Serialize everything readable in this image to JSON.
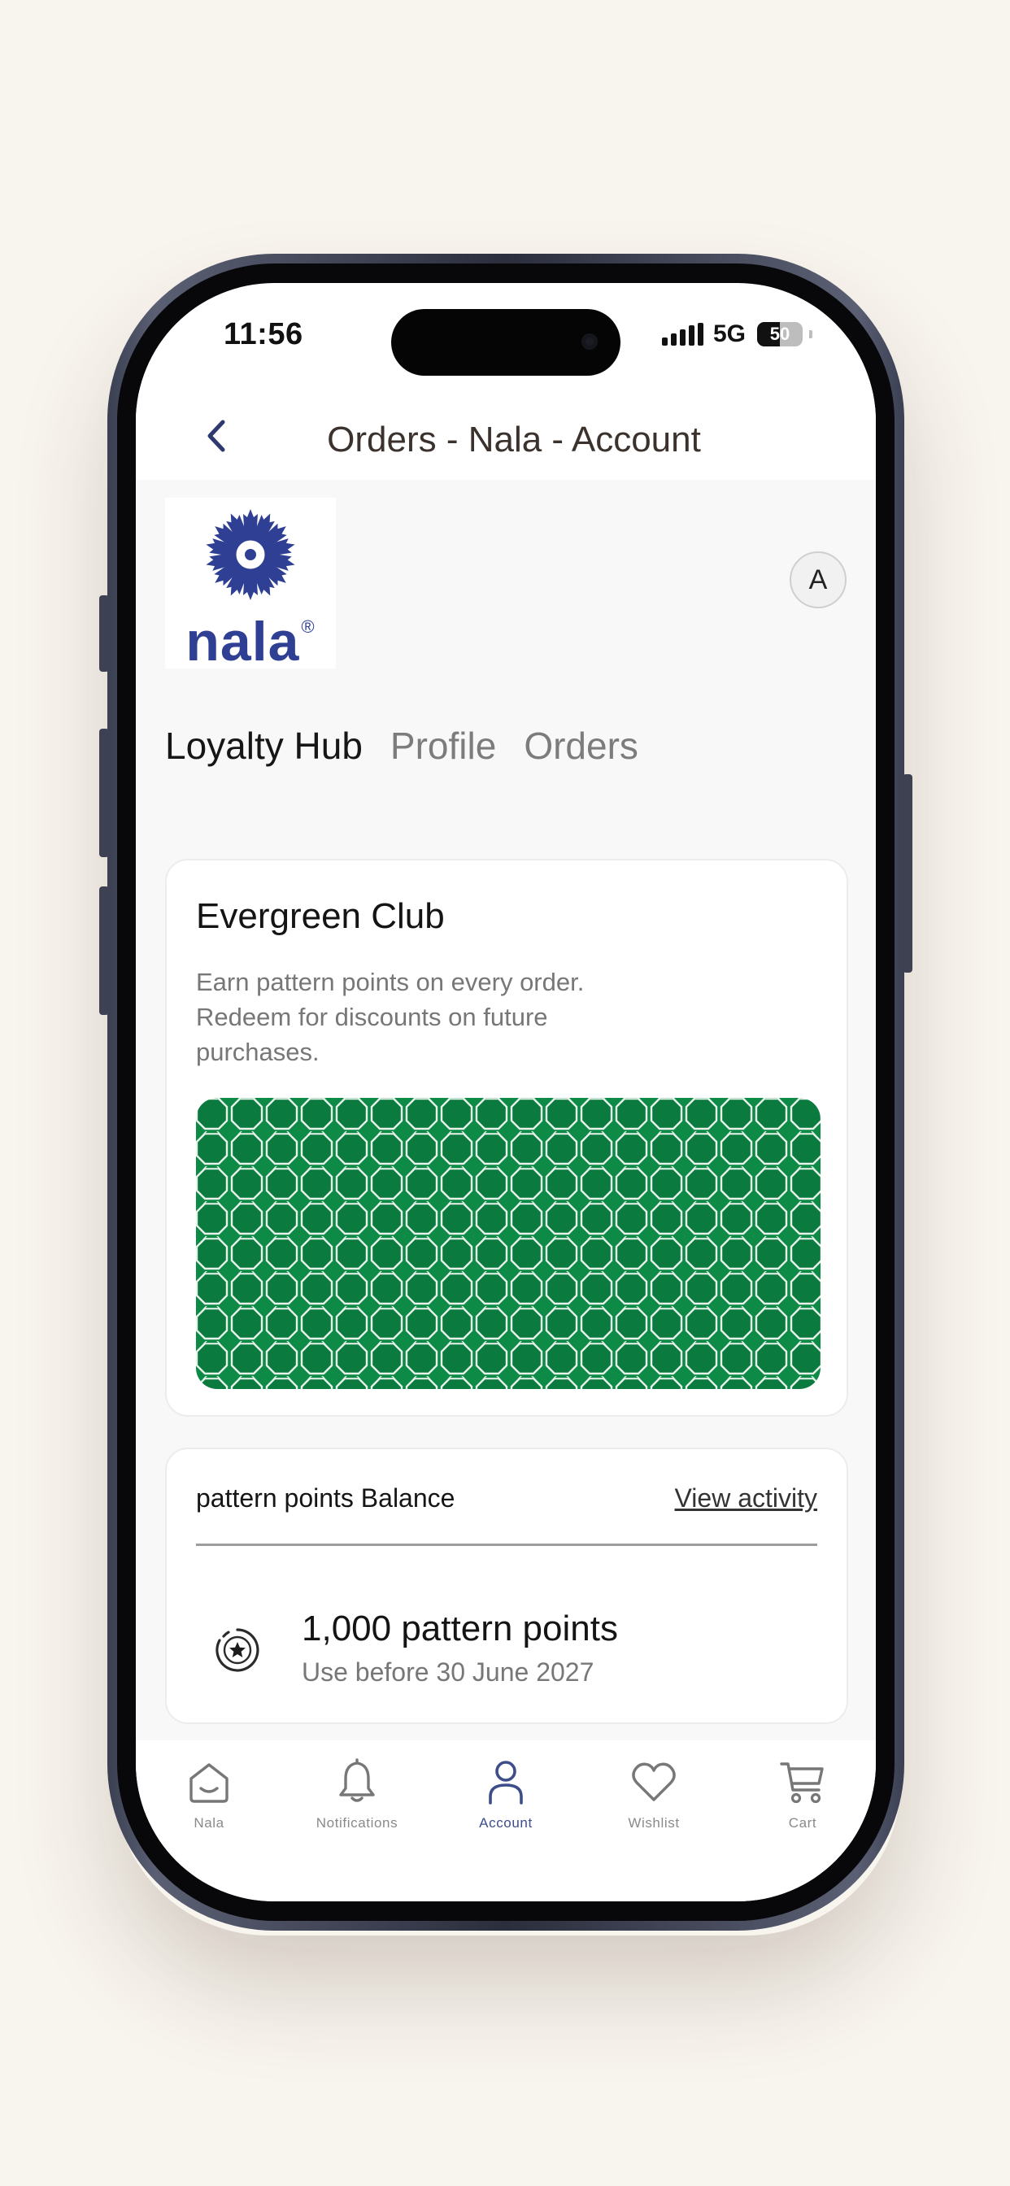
{
  "status_bar": {
    "time": "11:56",
    "network": "5G",
    "battery": "50",
    "battery_level_percent": 50
  },
  "header": {
    "title": "Orders - Nala - Account",
    "back_icon": "chevron-left-icon"
  },
  "brand": {
    "name": "nala",
    "registered_mark": "®",
    "logo_icon": "flower-logo-icon"
  },
  "avatar": {
    "initial": "A"
  },
  "tabs": [
    {
      "label": "Loyalty Hub",
      "active": true
    },
    {
      "label": "Profile",
      "active": false
    },
    {
      "label": "Orders",
      "active": false
    }
  ],
  "club": {
    "title": "Evergreen Club",
    "description": "Earn pattern points on every order. Redeem for discounts on future purchases.",
    "pattern_color": "#0e8a47"
  },
  "balance": {
    "label": "pattern points Balance",
    "activity_link": "View activity",
    "amount": "1,000 pattern points",
    "expiry": "Use before 30 June 2027",
    "icon": "star-badge-icon"
  },
  "tabbar": {
    "items": [
      {
        "label": "Nala",
        "icon": "home-icon",
        "active": false
      },
      {
        "label": "Notifications",
        "icon": "bell-icon",
        "active": false
      },
      {
        "label": "Account",
        "icon": "person-icon",
        "active": true
      },
      {
        "label": "Wishlist",
        "icon": "heart-icon",
        "active": false
      },
      {
        "label": "Cart",
        "icon": "cart-icon",
        "active": false
      }
    ]
  },
  "colors": {
    "accent": "#2f3f94",
    "active_tab": "#3d4d8a",
    "page_background": "#f8f4ee"
  }
}
